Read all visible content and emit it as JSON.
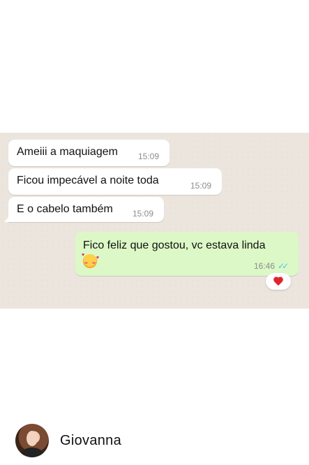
{
  "messages_in": [
    {
      "text": "Ameiii a maquiagem",
      "time": "15:09"
    },
    {
      "text": "Ficou impecável a noite toda",
      "time": "15:09"
    },
    {
      "text": "E o cabelo também",
      "time": "15:09"
    }
  ],
  "message_out": {
    "text": "Fico feliz que gostou, vc estava linda",
    "emoji": "smiling-face-with-hearts",
    "time": "16:46",
    "status": "read-double-check",
    "reaction": "heart"
  },
  "colors": {
    "chat_background": "#ece5dd",
    "incoming_bubble": "#ffffff",
    "outgoing_bubble": "#dcf8c6",
    "read_checks": "#4fc3f7",
    "reaction_heart": "#e0242f"
  },
  "profile": {
    "name": "Giovanna"
  }
}
